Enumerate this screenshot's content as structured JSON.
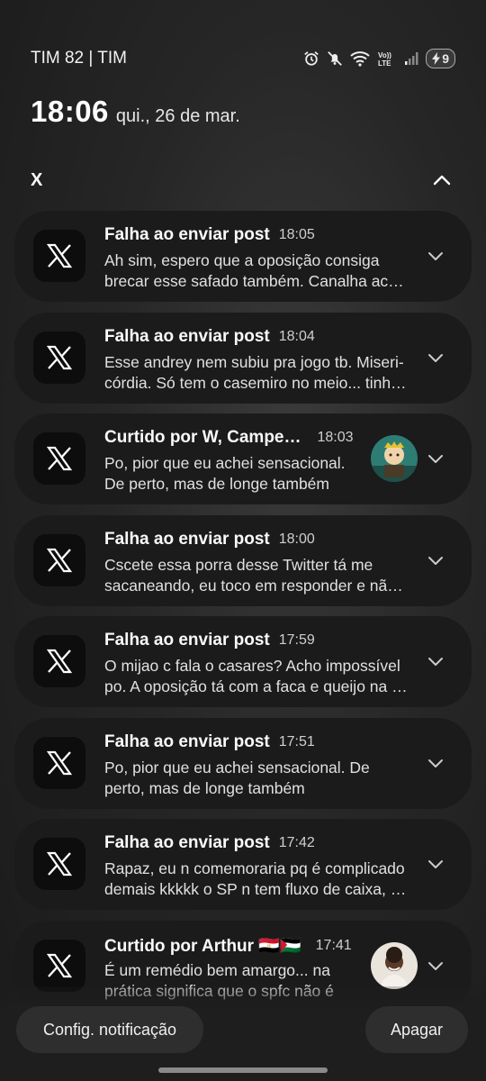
{
  "status_bar": {
    "carrier": "TIM 82 | TIM",
    "network": "Vo)) LTE",
    "battery": "9"
  },
  "clock": {
    "time": "18:06",
    "date": "qui., 26 de mar."
  },
  "group": {
    "app": "X"
  },
  "notifications": [
    {
      "title": "Falha ao enviar post",
      "time": "18:05",
      "line1": "Ah sim, espero que a oposição consiga",
      "line2": "brecar esse safado também. Canalha ac…"
    },
    {
      "title": "Falha ao enviar post",
      "time": "18:04",
      "line1": "Esse andrey nem subiu pra jogo tb. Miseri-",
      "line2": "córdia. Só tem o casemiro no meio... tinh…"
    },
    {
      "title": "Curtido por W, Campe…",
      "time": "18:03",
      "line1": "Po, pior que eu achei sensacional.",
      "line2": "De perto, mas de longe também"
    },
    {
      "title": "Falha ao enviar post",
      "time": "18:00",
      "line1": "Cscete essa porra desse Twitter tá me",
      "line2": "sacaneando, eu toco em responder e nã…"
    },
    {
      "title": "Falha ao enviar post",
      "time": "17:59",
      "line1": "O mijao c fala o casares? Acho impossível",
      "line2": "po. A oposição tá com a faca e queijo na …"
    },
    {
      "title": "Falha ao enviar post",
      "time": "17:51",
      "line1": "Po, pior que eu achei sensacional. De",
      "line2": "perto, mas de longe também"
    },
    {
      "title": "Falha ao enviar post",
      "time": "17:42",
      "line1": "Rapaz, eu n comemoraria pq é complicado",
      "line2": "demais kkkkk o SP n tem fluxo de caixa, …"
    },
    {
      "title": "Curtido por Arthur 🇪🇬🇵🇸",
      "time": "17:41",
      "line1": "É um remédio bem amargo... na",
      "line2": "prática significa que o spfc não é"
    }
  ],
  "actions": {
    "settings": "Config. notificação",
    "clear": "Apagar"
  }
}
